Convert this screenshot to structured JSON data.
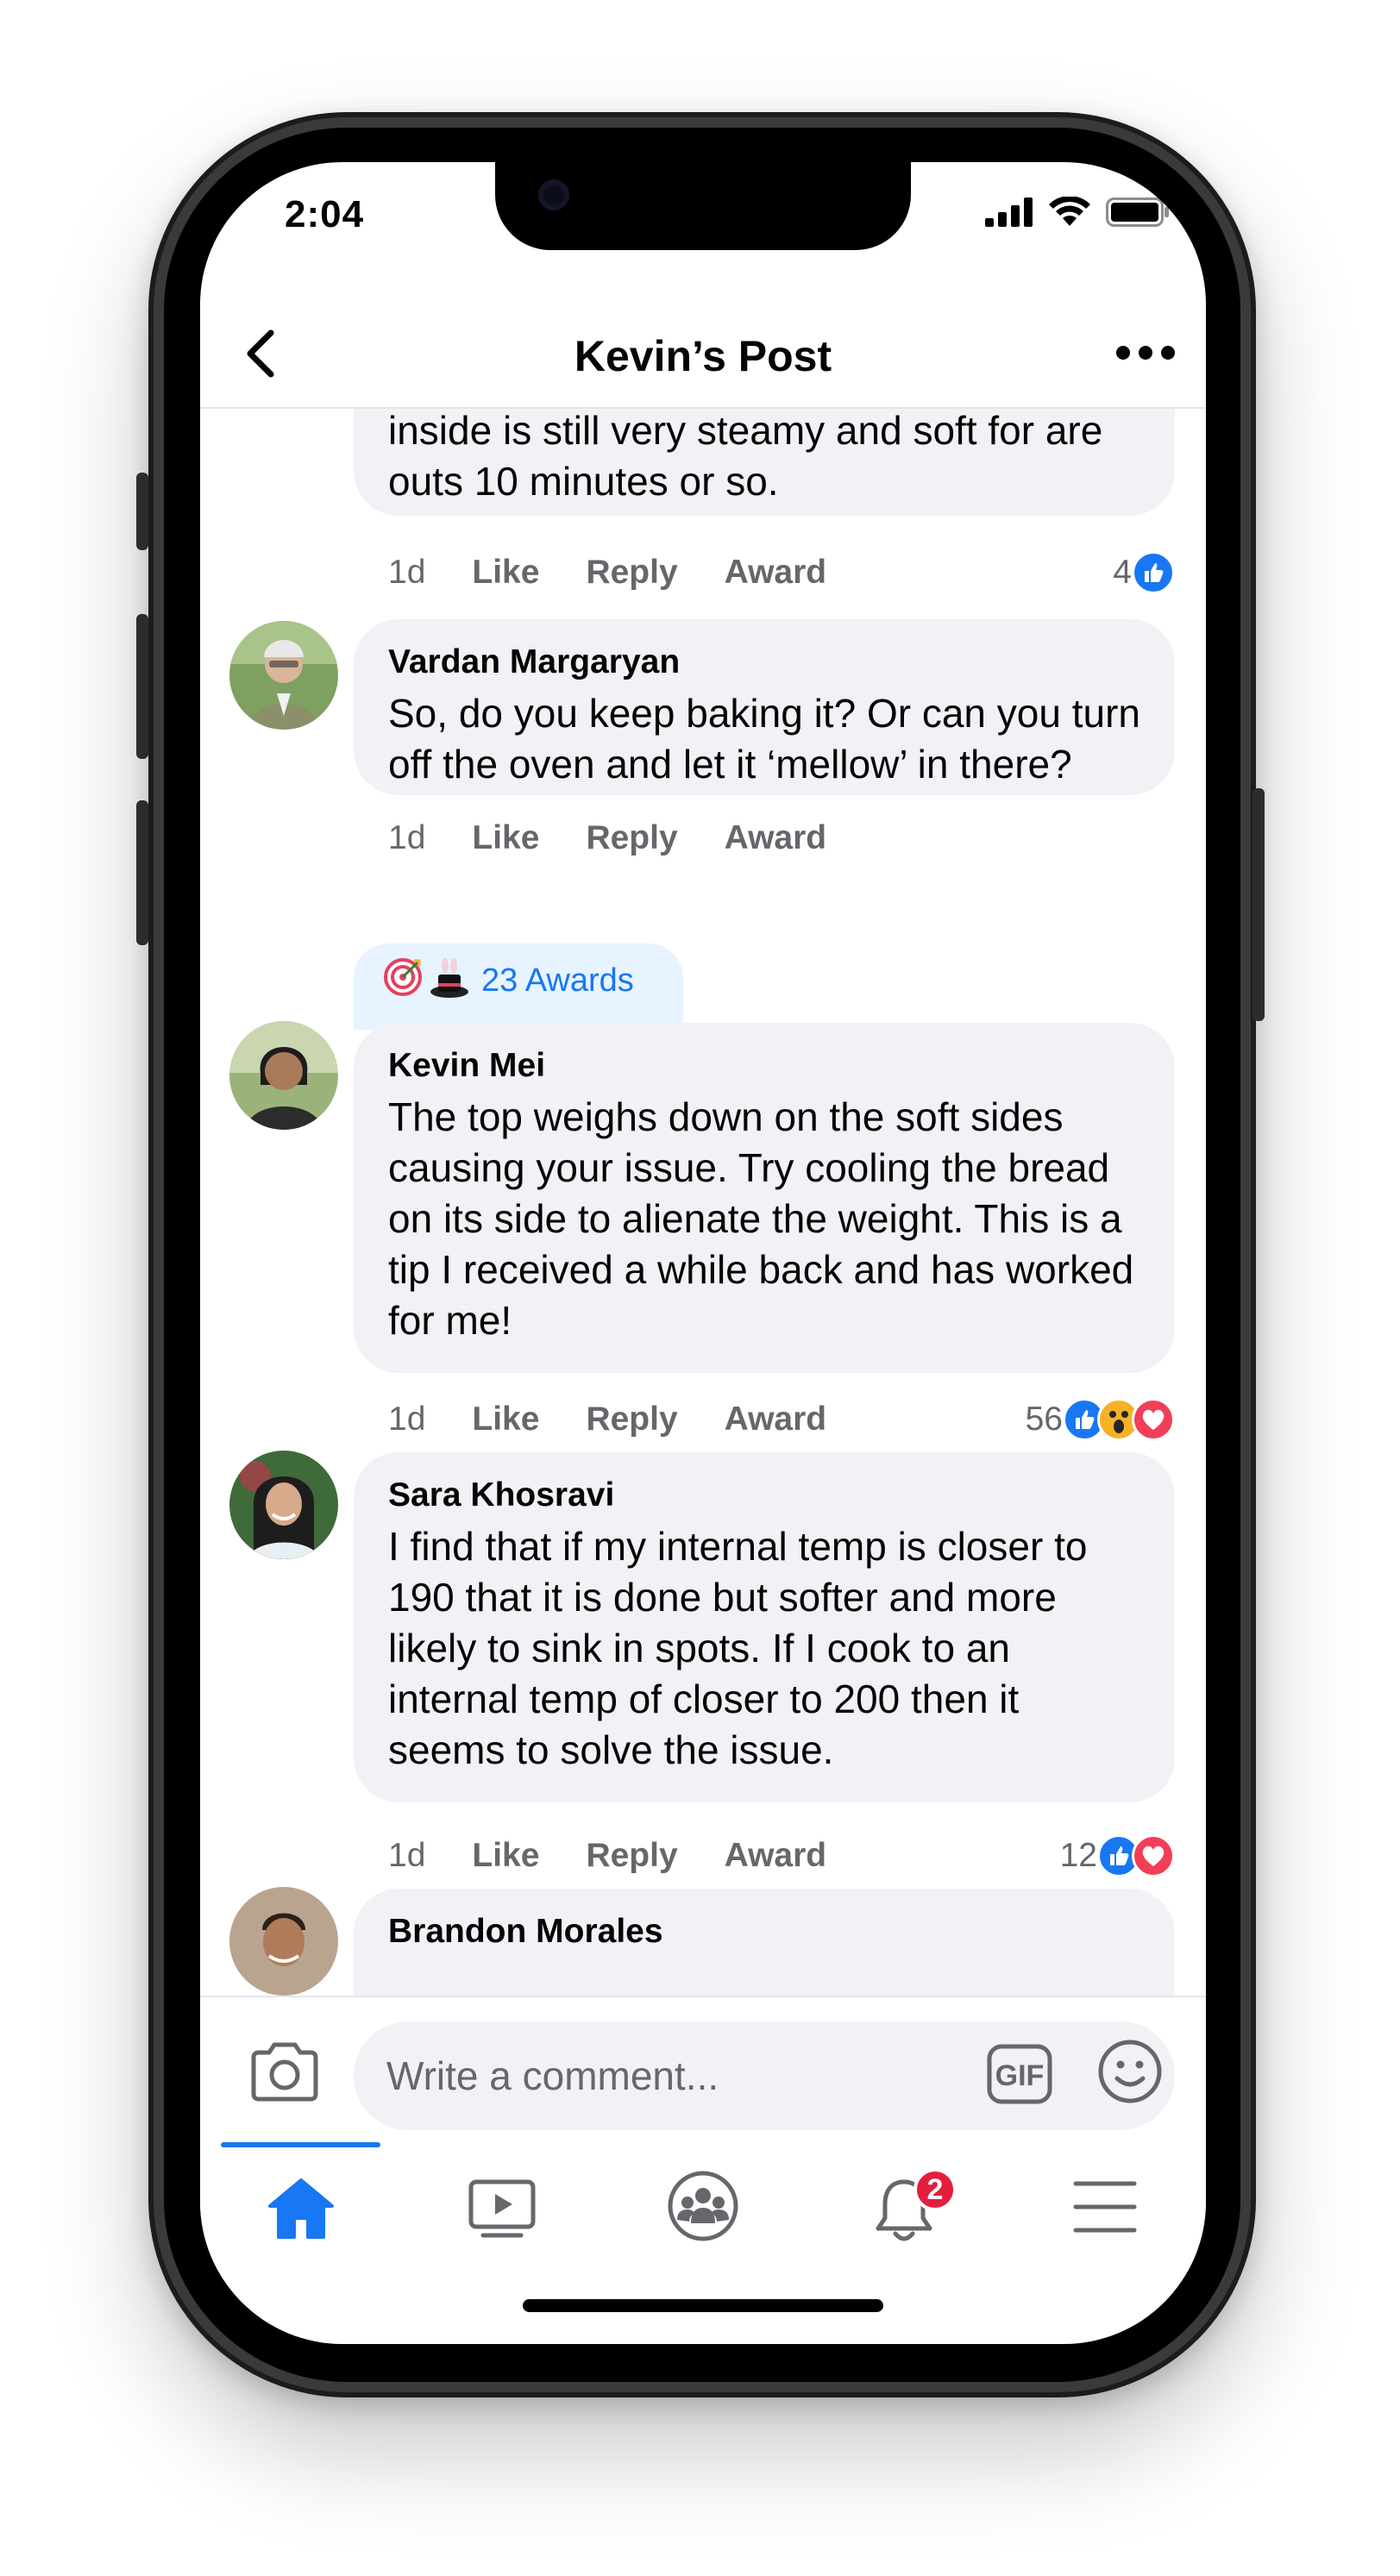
{
  "status_bar": {
    "time": "2:04"
  },
  "header": {
    "title": "Kevin’s Post"
  },
  "comments": [
    {
      "author": "",
      "text": "inside is still very steamy and soft for are outs 10 minutes or so.",
      "time": "1d",
      "actions": [
        "Like",
        "Reply",
        "Award"
      ],
      "reaction_count": "4",
      "reactions": [
        "like"
      ]
    },
    {
      "author": "Vardan Margaryan",
      "text": "So, do you keep baking it? Or can you turn off the oven and let it ‘mellow’ in there?",
      "time": "1d",
      "actions": [
        "Like",
        "Reply",
        "Award"
      ]
    },
    {
      "awards_label": "23 Awards",
      "author": "Kevin Mei",
      "text": "The top weighs down on the soft sides causing your issue. Try cooling the bread on its side to alienate the weight. This is a tip I received a while back and has worked for me!",
      "time": "1d",
      "actions": [
        "Like",
        "Reply",
        "Award"
      ],
      "reaction_count": "56",
      "reactions": [
        "like",
        "wow",
        "love"
      ]
    },
    {
      "author": "Sara Khosravi",
      "text": "I find that if my internal temp is closer to 190 that it is done but softer and more likely to sink in spots. If I cook to an internal temp of closer to 200 then it seems to solve the issue.",
      "time": "1d",
      "actions": [
        "Like",
        "Reply",
        "Award"
      ],
      "reaction_count": "12",
      "reactions": [
        "like",
        "love"
      ]
    },
    {
      "author": "Brandon Morales"
    }
  ],
  "composer": {
    "placeholder": "Write a comment...",
    "icons": [
      "camera-icon",
      "gif-icon",
      "emoji-icon"
    ]
  },
  "tabbar": {
    "tabs": [
      "home",
      "watch",
      "groups",
      "notifications",
      "menu"
    ],
    "active": "home",
    "notification_badge": "2"
  },
  "colors": {
    "accent": "#1877f2",
    "bubble": "#f0f2f5",
    "secondary_text": "#65676b",
    "badge": "#e41e3f",
    "love": "#f33e58",
    "wow": "#f7b125"
  }
}
